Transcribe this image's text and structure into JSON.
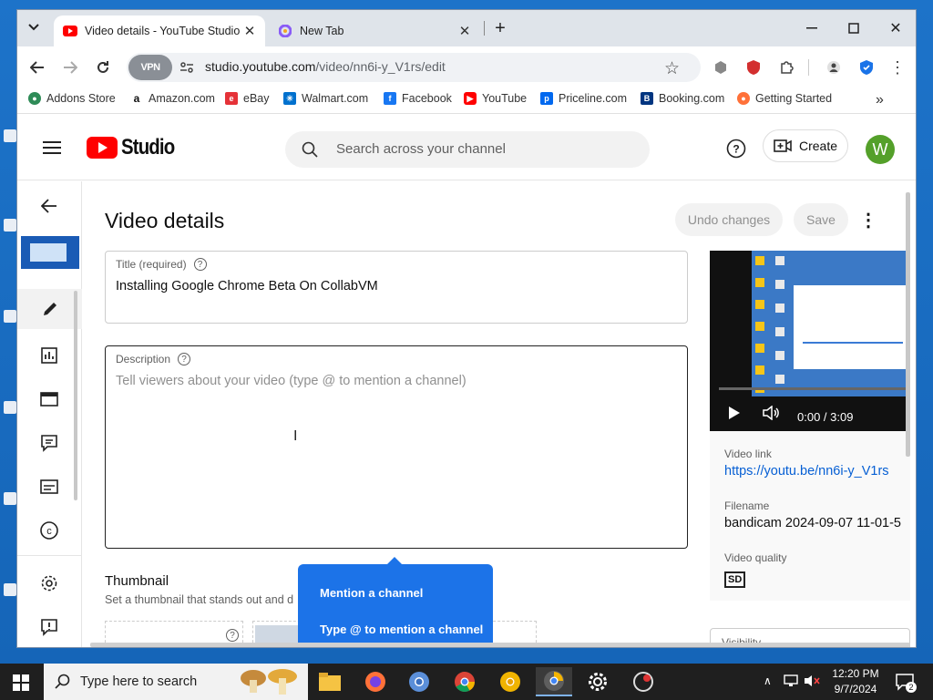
{
  "browser": {
    "tabs": [
      {
        "title": "Video details - YouTube Studio",
        "active": true
      },
      {
        "title": "New Tab",
        "active": false
      }
    ],
    "url_host": "studio.youtube.com",
    "url_path": "/video/nn6i-y_V1rs/edit",
    "vpn_label": "VPN",
    "bookmarks": [
      "Addons Store",
      "Amazon.com",
      "eBay",
      "Walmart.com",
      "Facebook",
      "YouTube",
      "Priceline.com",
      "Booking.com",
      "Getting Started"
    ]
  },
  "studio": {
    "logo_text": "Studio",
    "search_placeholder": "Search across your channel",
    "create_label": "Create",
    "avatar_letter": "W"
  },
  "page": {
    "title": "Video details",
    "undo_label": "Undo changes",
    "save_label": "Save",
    "title_field_label": "Title (required)",
    "title_value": "Installing Google Chrome Beta On CollabVM",
    "desc_label": "Description",
    "desc_placeholder": "Tell viewers about your video (type @ to mention a channel)",
    "thumbnail_heading": "Thumbnail",
    "thumbnail_sub": "Set a thumbnail that stands out and d"
  },
  "popup": {
    "line1": "Mention a channel",
    "line2": "Type @ to mention a channel"
  },
  "video": {
    "time": "0:00 / 3:09",
    "link_label": "Video link",
    "link": "https://youtu.be/nn6i-y_V1rs",
    "filename_label": "Filename",
    "filename": "bandicam 2024-09-07 11-01-5",
    "quality_label": "Video quality",
    "quality_badge": "SD",
    "visibility_label": "Visibility"
  },
  "taskbar": {
    "search_text": "Type here to search",
    "time": "12:20 PM",
    "date": "9/7/2024",
    "notif_count": "2"
  },
  "colors": {
    "accent": "#1c73e8",
    "brand_red": "#ff0000",
    "link": "#065fd4"
  }
}
